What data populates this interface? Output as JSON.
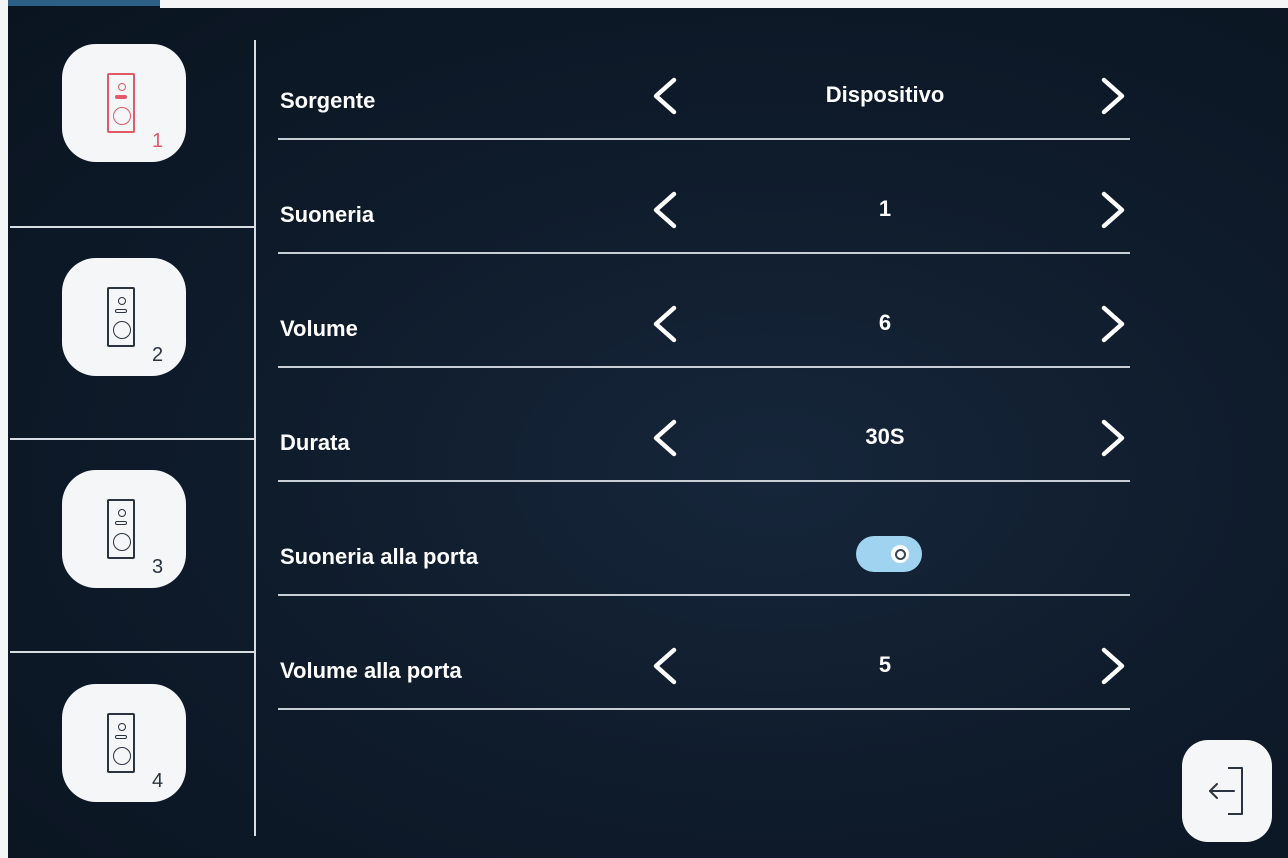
{
  "sidebar": {
    "devices": [
      {
        "number": "1",
        "active": true
      },
      {
        "number": "2",
        "active": false
      },
      {
        "number": "3",
        "active": false
      },
      {
        "number": "4",
        "active": false
      }
    ]
  },
  "settings": {
    "source": {
      "label": "Sorgente",
      "value": "Dispositivo"
    },
    "ringtone": {
      "label": "Suoneria",
      "value": "1"
    },
    "volume": {
      "label": "Volume",
      "value": "6"
    },
    "duration": {
      "label": "Durata",
      "value": "30S"
    },
    "door_ringtone": {
      "label": "Suoneria alla porta",
      "enabled": true
    },
    "door_volume": {
      "label": "Volume alla porta",
      "value": "5"
    }
  },
  "icons": {
    "prev": "chevron-left-icon",
    "next": "chevron-right-icon",
    "back": "exit-icon",
    "device": "doorbell-icon"
  },
  "colors": {
    "background": "#0f1c2c",
    "active_accent": "#e35a67",
    "toggle_on": "#9fd3ef",
    "button_bg": "#f4f6f8"
  }
}
